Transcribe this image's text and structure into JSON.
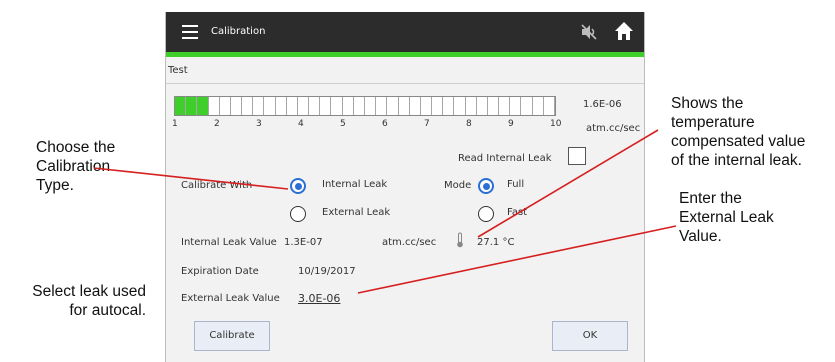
{
  "app": {
    "title": "Calibration",
    "section": "Test",
    "leak_gauge": {
      "scale": [
        "1",
        "2",
        "3",
        "4",
        "5",
        "6",
        "7",
        "8",
        "9",
        "10"
      ],
      "level_fraction": 0.075,
      "value": "1.6E-06",
      "unit": "atm.cc/sec",
      "fill_color": "#3fcf2a"
    },
    "read_internal_leak_label": "Read Internal Leak",
    "calibrate_with_label": "Calibrate With",
    "internal_leak_option": "Internal Leak",
    "external_leak_option": "External Leak",
    "selected_leak": "Internal Leak",
    "mode_label": "Mode",
    "mode_full": "Full",
    "mode_fast": "Fast",
    "selected_mode": "Full",
    "internal_leak_value_label": "Internal Leak Value",
    "internal_leak_value": "1.3E-07",
    "internal_leak_unit": "atm.cc/sec",
    "temperature": "27.1",
    "temperature_unit": "°C",
    "expiration_date_label": "Expiration Date",
    "expiration_date": "10/19/2017",
    "external_leak_value_label": "External Leak Value",
    "external_leak_value": "3.0E-06",
    "calibrate_button": "Calibrate",
    "ok_button": "OK",
    "icons": [
      "menu-icon",
      "mute-icon",
      "home-icon",
      "thermometer-icon"
    ],
    "accent_color": "#3fcf2a",
    "radio_color": "#2a6fd6"
  },
  "annotations": {
    "choose_type": [
      "Choose the",
      "Calibration",
      "Type."
    ],
    "select_leak": [
      "Select leak used",
      "for autocal."
    ],
    "shows_temp": [
      "Shows the",
      "temperature",
      "compensated value",
      "of the internal leak."
    ],
    "enter_external": [
      "Enter the",
      "External Leak",
      "Value."
    ],
    "line_color": "#d61f1f"
  }
}
